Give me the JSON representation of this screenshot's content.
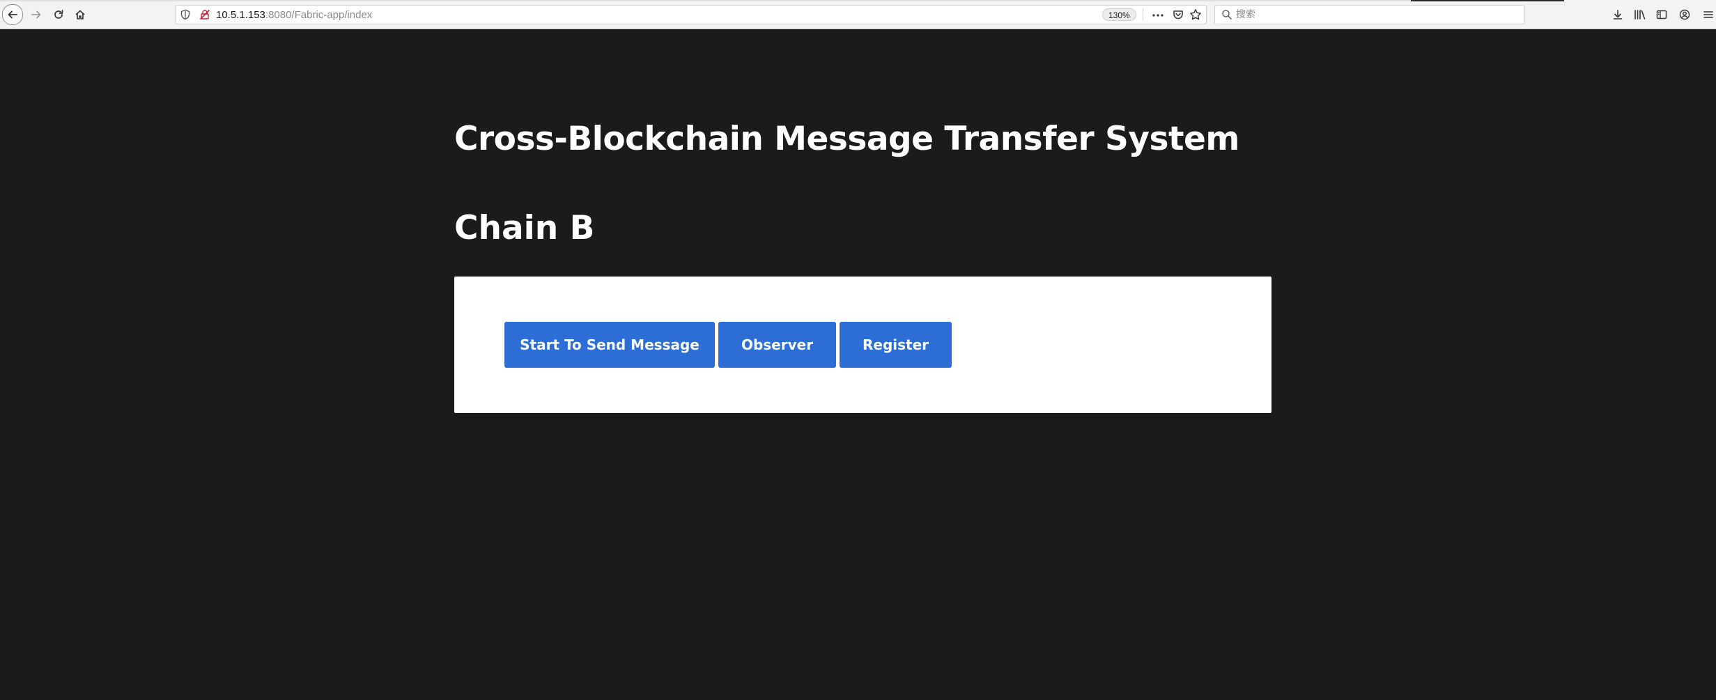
{
  "browser": {
    "url": {
      "host": "10.5.1.153",
      "rest": ":8080/Fabric-app/index"
    },
    "zoom": "130%",
    "search": {
      "placeholder": "搜索"
    }
  },
  "page": {
    "title": "Cross-Blockchain Message Transfer System",
    "subtitle": "Chain B",
    "buttons": {
      "start": "Start To Send Message",
      "observer": "Observer",
      "register": "Register"
    }
  },
  "colors": {
    "page_background": "#1b1b1b",
    "card_background": "#ffffff",
    "button_blue": "#2d6ed6",
    "heading_text": "#ffffff"
  }
}
